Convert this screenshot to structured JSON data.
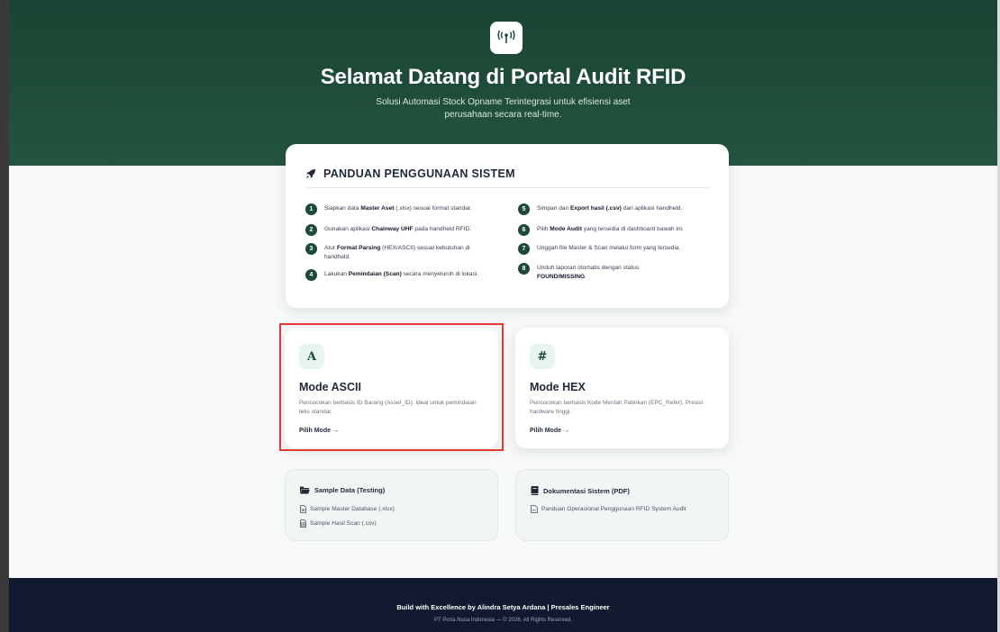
{
  "hero": {
    "title": "Selamat Datang di Portal Audit RFID",
    "subtitle_line1": "Solusi Automasi Stock Opname Terintegrasi untuk efisiensi aset",
    "subtitle_line2": "perusahaan secara real-time.",
    "logo_icon": "antenna-signal-icon",
    "brand_color": "#1f4d3a"
  },
  "guide": {
    "title": "PANDUAN PENGGUNAAN SISTEM",
    "icon": "rocket-icon",
    "steps": [
      {
        "num": "1",
        "pre": "Siapkan data ",
        "bold": "Master Aset",
        "post": " (.xlsx) sesuai format standar."
      },
      {
        "num": "2",
        "pre": "Gunakan aplikasi ",
        "bold": "Chainway UHF",
        "post": " pada handheld RFID."
      },
      {
        "num": "3",
        "pre": "Atur ",
        "bold": "Format Parsing",
        "post": " (HEX/ASCII) sesuai kebutuhan di handheld."
      },
      {
        "num": "4",
        "pre": "Lakukan ",
        "bold": "Pemindaian (Scan)",
        "post": " secara menyeluruh di lokasi."
      },
      {
        "num": "5",
        "pre": "Simpan dan ",
        "bold": "Export hasil (.csv)",
        "post": " dari aplikasi handheld."
      },
      {
        "num": "6",
        "pre": "Pilih ",
        "bold": "Mode Audit",
        "post": " yang tersedia di dashboard bawah ini."
      },
      {
        "num": "7",
        "pre": "Unggah file Master & Scan melalui form yang tersedia.",
        "bold": "",
        "post": ""
      },
      {
        "num": "8",
        "pre": "Unduh laporan otomatis dengan status ",
        "bold": "FOUND/MISSING",
        "post": "."
      }
    ]
  },
  "modes": {
    "ascii": {
      "icon_letter": "A",
      "title": "Mode ASCII",
      "desc": "Pencocokan berbasis ID Barang (Asset_ID). Ideal untuk pemindaian teks standar.",
      "cta": "Pilih Mode →"
    },
    "hex": {
      "icon_letter": "#",
      "title": "Mode HEX",
      "desc": "Pencocokan berbasis Kode Mentah Pabrikan (EPC_Refer). Presisi hardware tinggi.",
      "cta": "Pilih Mode →"
    }
  },
  "resources": {
    "sample": {
      "title": "Sample Data (Testing)",
      "icon": "folder-open-icon",
      "links": [
        "Sample Master Database (.xlsx)",
        "Sample Hasil Scan (.csv)"
      ]
    },
    "docs": {
      "title": "Dokumentasi Sistem (PDF)",
      "icon": "book-icon",
      "links": [
        "Panduan Operasional Penggunaan RFID System Audit"
      ]
    }
  },
  "footer": {
    "main": "Build with Excellence by Alindra Setya Ardana | Presales Engineer",
    "sub": "PT Porta Nusa Indonesia — © 2026. All Rights Reserved."
  }
}
